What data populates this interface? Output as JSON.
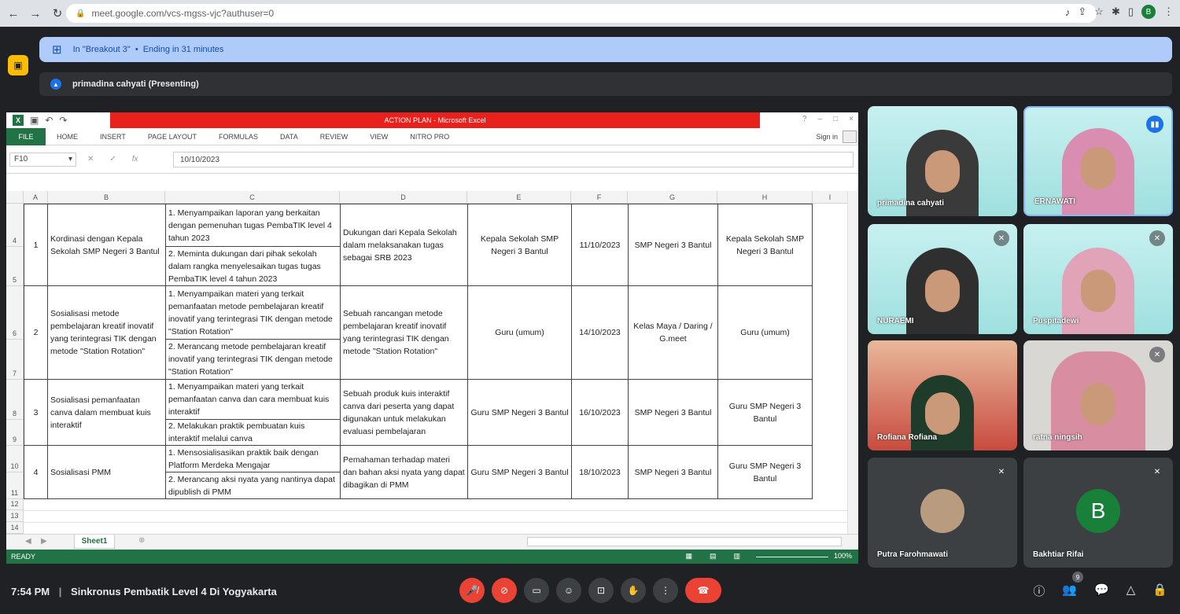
{
  "browser": {
    "url": "meet.google.com/vcs-mgss-vjc?authuser=0"
  },
  "breakout_banner": {
    "room": "In \"Breakout 3\"",
    "separator": "•",
    "ending": "Ending in 31 minutes"
  },
  "presenting": {
    "label": "primadina cahyati (Presenting)"
  },
  "excel": {
    "title": "ACTION PLAN - Microsoft Excel",
    "tabs": [
      "FILE",
      "HOME",
      "INSERT",
      "PAGE LAYOUT",
      "FORMULAS",
      "DATA",
      "REVIEW",
      "VIEW",
      "NITRO PRO"
    ],
    "sign_in": "Sign in",
    "name_box": "F10",
    "formula_value": "10/10/2023",
    "columns": [
      "A",
      "B",
      "C",
      "D",
      "E",
      "F",
      "G",
      "H",
      "I"
    ],
    "row_numbers": [
      "4",
      "5",
      "6",
      "7",
      "8",
      "9",
      "10",
      "11",
      "12",
      "13",
      "14"
    ],
    "rows": [
      {
        "no": "1",
        "activity": "Kordinasi dengan Kepala Sekolah SMP Negeri 3 Bantul",
        "steps": [
          "1. Menyampaikan laporan yang berkaitan dengan pemenuhan tugas PembaTIK level 4 tahun 2023",
          "2. Meminta dukungan dari pihak sekolah dalam rangka menyelesaikan tugas tugas PembaTIK level 4 tahun 2023"
        ],
        "output": "Dukungan dari Kepala Sekolah dalam melaksanakan tugas sebagai SRB 2023",
        "target": "Kepala Sekolah SMP Negeri 3 Bantul",
        "date": "11/10/2023",
        "place": "SMP Negeri 3 Bantul",
        "pic": "Kepala Sekolah SMP Negeri 3 Bantul"
      },
      {
        "no": "2",
        "activity": "Sosialisasi metode pembelajaran kreatif inovatif yang terintegrasi TIK dengan metode \"Station Rotation\"",
        "steps": [
          "1. Menyampaikan materi yang terkait pemanfaatan metode pembelajaran kreatif inovatif yang terintegrasi TIK dengan metode \"Station Rotation\"",
          "2. Merancang metode pembelajaran kreatif inovatif yang terintegrasi TIK dengan metode \"Station Rotation\""
        ],
        "output": "Sebuah rancangan metode pembelajaran kreatif inovatif yang terintegrasi TIK dengan metode \"Station Rotation\"",
        "target": "Guru (umum)",
        "date": "14/10/2023",
        "place": "Kelas Maya / Daring / G.meet",
        "pic": "Guru (umum)"
      },
      {
        "no": "3",
        "activity": "Sosialisasi pemanfaatan canva dalam membuat kuis interaktif",
        "steps": [
          "1. Menyampaikan materi yang terkait pemanfaatan canva dan cara membuat kuis interaktif",
          "2. Melakukan praktik pembuatan kuis interaktif melalui canva"
        ],
        "output": "Sebuah produk kuis interaktif canva dari peserta yang dapat digunakan untuk melakukan evaluasi pembelajaran",
        "target": "Guru SMP Negeri 3 Bantul",
        "date": "16/10/2023",
        "place": "SMP Negeri 3 Bantul",
        "pic": "Guru SMP Negeri 3 Bantul"
      },
      {
        "no": "4",
        "activity": "Sosialisasi PMM",
        "steps": [
          "1. Mensosialisasikan praktik baik dengan Platform Merdeka Mengajar",
          "2. Merancang aksi nyata yang nantinya dapat dipublish di PMM"
        ],
        "output": "Pemahaman terhadap materi dan bahan aksi nyata yang dapat dibagikan di PMM",
        "target": "Guru SMP Negeri 3 Bantul",
        "date": "18/10/2023",
        "place": "SMP Negeri 3 Bantul",
        "pic": "Guru SMP Negeri 3 Bantul"
      }
    ],
    "sheet_tab": "Sheet1",
    "status": "READY",
    "zoom": "100%"
  },
  "participants": [
    {
      "name": "primadina cahyati"
    },
    {
      "name": "ERNAWATI"
    },
    {
      "name": "NURAEMI"
    },
    {
      "name": "Puspitadewi"
    },
    {
      "name": "Rofiana Rofiana"
    },
    {
      "name": "ratna ningsih"
    },
    {
      "name": "Putra Farohmawati"
    },
    {
      "name": "Bakhtiar Rifai",
      "initial": "B"
    }
  ],
  "meeting": {
    "time": "7:54 PM",
    "title": "Sinkronus Pembatik Level 4 Di Yogyakarta",
    "people_count": "9"
  },
  "colors": {
    "excel_green": "#217346",
    "title_red": "#e8211c",
    "banner_blue": "#aecbfa",
    "meet_bg": "#202124",
    "end_call": "#ea4335"
  }
}
